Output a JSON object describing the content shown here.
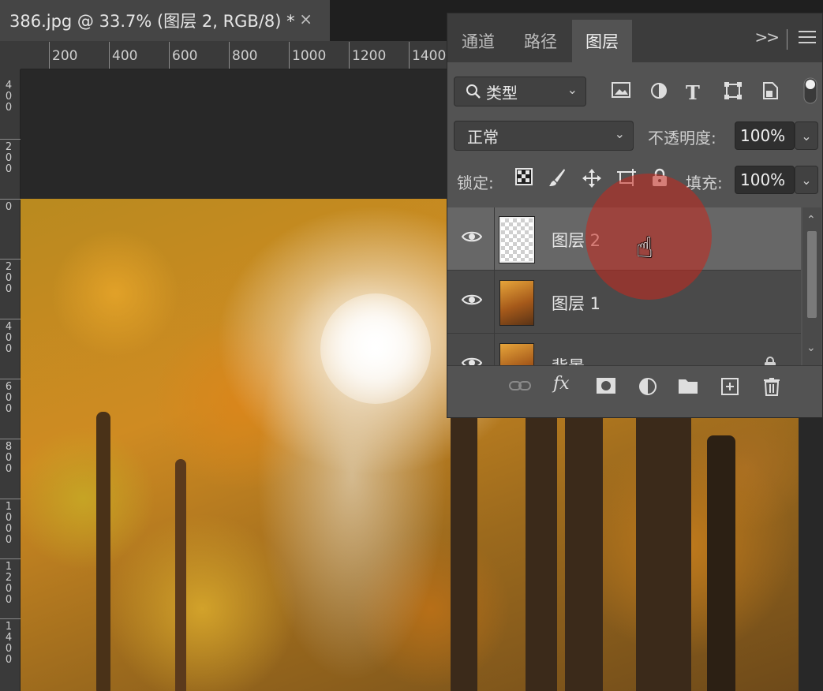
{
  "document_tab": {
    "title": "386.jpg @ 33.7% (图层 2, RGB/8) *",
    "close_glyph": "×"
  },
  "ruler": {
    "horizontal": [
      "200",
      "400",
      "600",
      "800",
      "1000",
      "1200",
      "1400"
    ],
    "vertical": [
      "4\n0\n0",
      "2\n0\n0",
      "0",
      "2\n0\n0",
      "4\n0\n0",
      "6\n0\n0",
      "8\n0\n0",
      "1\n0\n0\n0",
      "1\n2\n0\n0",
      "1\n4\n0\n0"
    ]
  },
  "panel": {
    "tabs": [
      {
        "label": "通道",
        "active": false
      },
      {
        "label": "路径",
        "active": false
      },
      {
        "label": "图层",
        "active": true
      }
    ],
    "collapse_glyph": ">>",
    "filter": {
      "label": "类型",
      "search_icon": "search-icon",
      "chevron": "⌄"
    },
    "filter_icons": [
      "image-filter-icon",
      "adjustment-filter-icon",
      "type-filter-icon",
      "shape-filter-icon",
      "smart-object-filter-icon"
    ],
    "blend_mode": "正常",
    "opacity_label": "不透明度:",
    "opacity_value": "100%",
    "lock_label": "锁定:",
    "fill_label": "填充:",
    "fill_value": "100%",
    "layers": [
      {
        "name": "图层 2",
        "thumbnail": "transparent",
        "visible": true,
        "selected": true
      },
      {
        "name": "图层 1",
        "thumbnail": "photo",
        "visible": true,
        "selected": false
      },
      {
        "name": "背景",
        "thumbnail": "photo",
        "visible": true,
        "selected": false,
        "locked": true
      }
    ],
    "bottom_actions": [
      "link-layers-icon",
      "fx-icon",
      "mask-icon",
      "adjustment-layer-icon",
      "group-folder-icon",
      "new-layer-icon",
      "trash-icon"
    ],
    "fx_label": "fx"
  },
  "colors": {
    "accent_highlight": "#c8281e",
    "panel_bg": "#535353",
    "selected_row": "#676767"
  }
}
